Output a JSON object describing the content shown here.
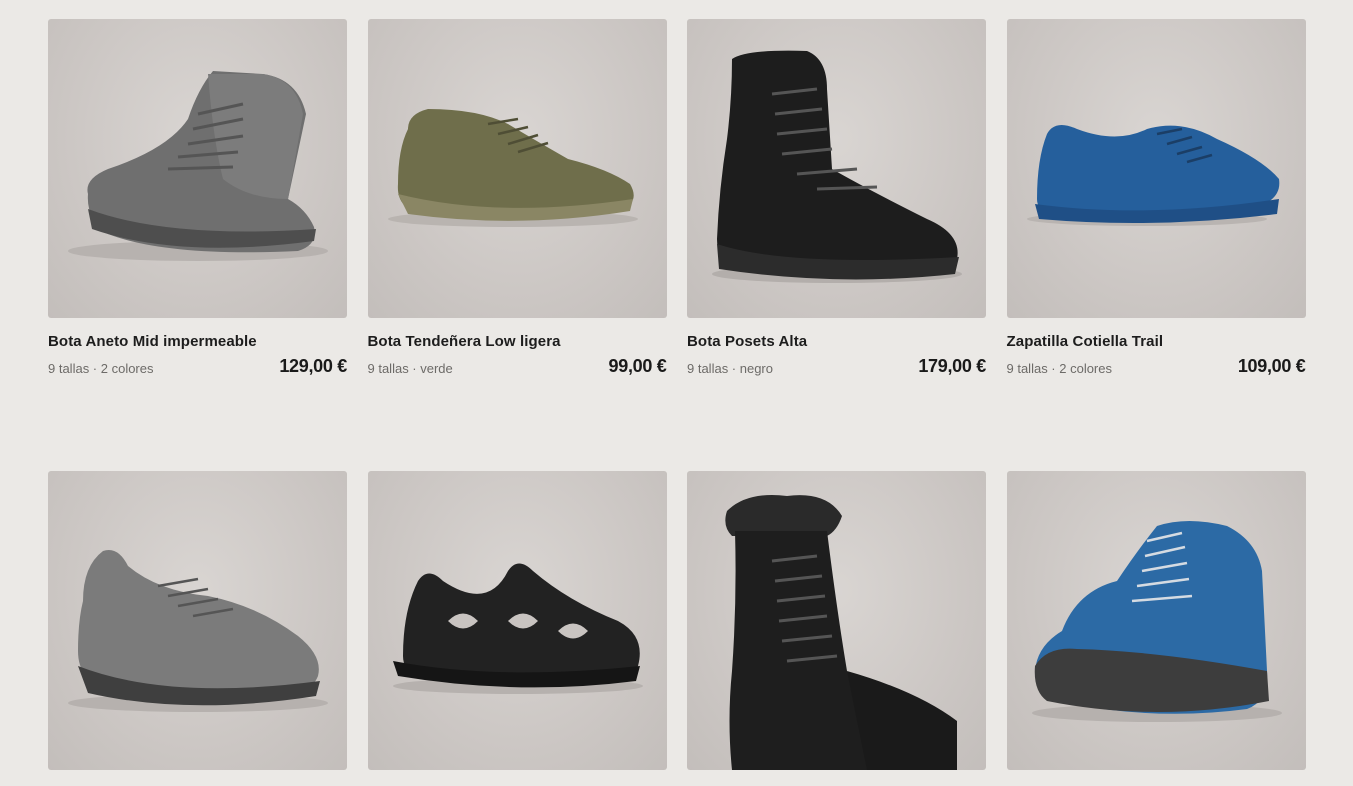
{
  "products": [
    {
      "name": "Bota Aneto Mid impermeable",
      "meta": "9 tallas · 2 colores",
      "price": "129,00 €",
      "image": "grey-mid-hiking-boot"
    },
    {
      "name": "Bota Tendeñera Low ligera",
      "meta": "9 tallas · verde",
      "price": "99,00 €",
      "image": "olive-low-hiking-shoe"
    },
    {
      "name": "Bota Posets Alta",
      "meta": "9 tallas · negro",
      "price": "179,00 €",
      "image": "black-high-mountain-boot"
    },
    {
      "name": "Zapatilla Cotiella Trail",
      "meta": "9 tallas · 2 colores",
      "price": "109,00 €",
      "image": "blue-trail-running-shoe"
    },
    {
      "name": "",
      "meta": "",
      "price": "",
      "image": "grey-approach-shoe"
    },
    {
      "name": "",
      "meta": "",
      "price": "",
      "image": "black-hiking-sandal"
    },
    {
      "name": "",
      "meta": "",
      "price": "",
      "image": "black-winter-boot-fur-collar"
    },
    {
      "name": "",
      "meta": "",
      "price": "",
      "image": "blue-kids-hiking-boot"
    }
  ],
  "colors": {
    "background": "#ebe9e6",
    "image_bg": "#cdc8c5",
    "text": "#1d1d1d",
    "meta_text": "#6d6b68"
  }
}
